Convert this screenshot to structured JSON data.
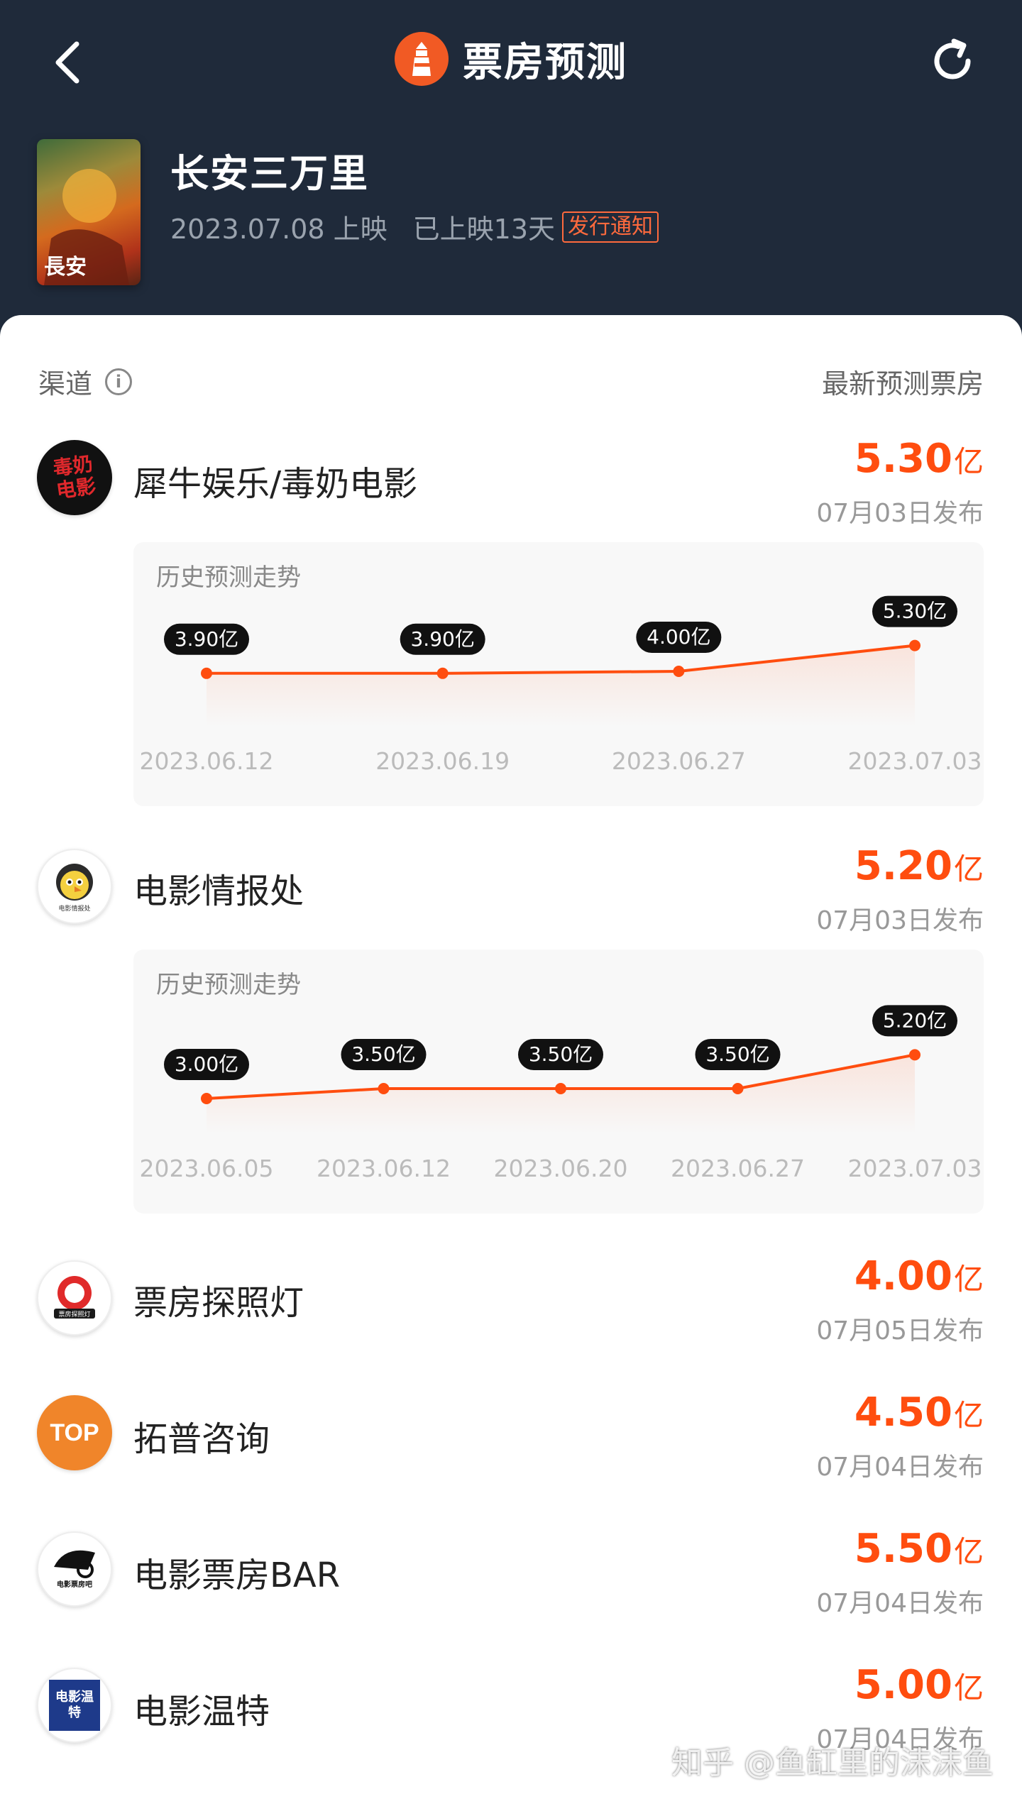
{
  "header": {
    "title": "票房预测",
    "refresh_icon": "refresh-icon",
    "back_icon": "chevron-left-icon"
  },
  "movie": {
    "title": "长安三万里",
    "release": "2023.07.08 上映",
    "days": "已上映13天",
    "tag": "发行通知"
  },
  "columns": {
    "channel": "渠道",
    "latest": "最新预测票房"
  },
  "channels": [
    {
      "name": "犀牛娱乐/毒奶电影",
      "value": "5.30",
      "unit": "亿",
      "date": "07月03日发布",
      "trend_title": "历史预测走势",
      "avatar_text": "毒奶电影",
      "chart_data": {
        "type": "line",
        "x": [
          "2023.06.12",
          "2023.06.19",
          "2023.06.27",
          "2023.07.03"
        ],
        "values": [
          3.9,
          3.9,
          4.0,
          5.3
        ],
        "labels": [
          "3.90亿",
          "3.90亿",
          "4.00亿",
          "5.30亿"
        ]
      }
    },
    {
      "name": "电影情报处",
      "value": "5.20",
      "unit": "亿",
      "date": "07月03日发布",
      "trend_title": "历史预测走势",
      "avatar_text": "电影情报处",
      "chart_data": {
        "type": "line",
        "x": [
          "2023.06.05",
          "2023.06.12",
          "2023.06.20",
          "2023.06.27",
          "2023.07.03"
        ],
        "values": [
          3.0,
          3.5,
          3.5,
          3.5,
          5.2
        ],
        "labels": [
          "3.00亿",
          "3.50亿",
          "3.50亿",
          "3.50亿",
          "5.20亿"
        ]
      }
    },
    {
      "name": "票房探照灯",
      "value": "4.00",
      "unit": "亿",
      "date": "07月05日发布",
      "avatar_text": "票房探照灯"
    },
    {
      "name": "拓普咨询",
      "value": "4.50",
      "unit": "亿",
      "date": "07月04日发布",
      "avatar_text": "TOP"
    },
    {
      "name": "电影票房BAR",
      "value": "5.50",
      "unit": "亿",
      "date": "07月04日发布",
      "avatar_text": "电影票房吧"
    },
    {
      "name": "电影温特",
      "value": "5.00",
      "unit": "亿",
      "date": "07月04日发布",
      "avatar_text": "电影温特"
    }
  ],
  "watermark": "知乎 @鱼缸里的沫沫鱼",
  "colors": {
    "accent": "#ff4d0f",
    "header_bg": "#1f2a3a"
  }
}
